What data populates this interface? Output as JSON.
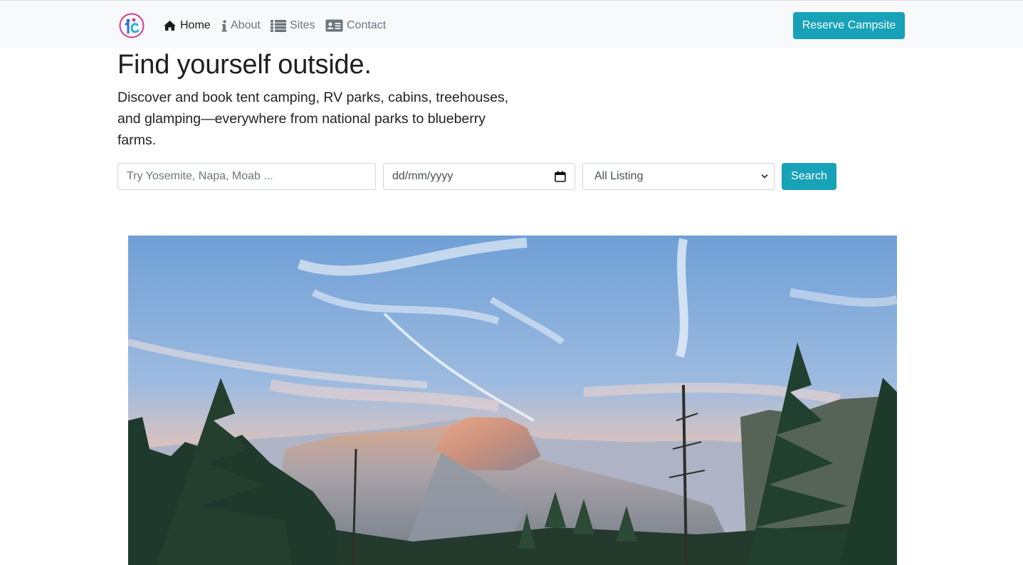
{
  "nav": {
    "logo_icon": "campground-logo-icon",
    "links": [
      {
        "label": "Home",
        "icon": "home-icon",
        "active": true
      },
      {
        "label": "About",
        "icon": "info-icon",
        "active": false
      },
      {
        "label": "Sites",
        "icon": "list-icon",
        "active": false
      },
      {
        "label": "Contact",
        "icon": "contact-card-icon",
        "active": false
      }
    ],
    "reserve_label": "Reserve Campsite"
  },
  "hero": {
    "headline": "Find yourself outside.",
    "lead": "Discover and book tent camping, RV parks, cabins, treehouses, and glamping—everywhere from national parks to blueberry farms."
  },
  "search": {
    "location_placeholder": "Try Yosemite, Napa, Moab ...",
    "date_placeholder": "dd/mm/yyyy",
    "listing_selected": "All Listing",
    "search_label": "Search"
  },
  "colors": {
    "accent": "#17a2b8",
    "navbar_bg": "#f8f9fa"
  }
}
